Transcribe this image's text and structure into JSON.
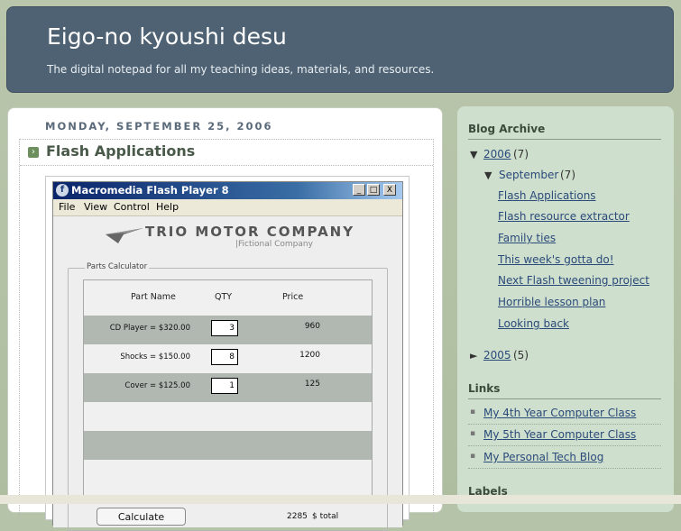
{
  "header": {
    "title": "Eigo-no kyoushi desu",
    "description": "The digital notepad for all my teaching ideas, materials, and resources."
  },
  "post": {
    "date": "MONDAY, SEPTEMBER 25, 2006",
    "title": "Flash Applications",
    "flash": {
      "window_title": "Macromedia Flash Player 8",
      "window_buttons": [
        "_",
        "□",
        "X"
      ],
      "menu": [
        "File",
        "View",
        "Control",
        "Help"
      ],
      "logo_text": "TRIO MOTOR COMPANY",
      "logo_sub": "|Fictional Company",
      "group_label": "Parts Calculator",
      "columns": [
        "Part Name",
        "QTY",
        "Price"
      ],
      "rows": [
        {
          "part": "CD Player = $320.00",
          "qty": "3",
          "price": "960"
        },
        {
          "part": "Shocks  = $150.00",
          "qty": "8",
          "price": "1200"
        },
        {
          "part": "Cover = $125.00",
          "qty": "1",
          "price": "125"
        }
      ],
      "calculate_label": "Calculate",
      "total_value": "2285",
      "total_label": "$ total"
    }
  },
  "sidebar": {
    "archive_heading": "Blog Archive",
    "years": [
      {
        "toggle": "▼",
        "year": "2006",
        "count": "(7)"
      },
      {
        "toggle": "►",
        "year": "2005",
        "count": "(5)"
      }
    ],
    "month": {
      "toggle": "▼",
      "name": "September",
      "count": "(7)"
    },
    "posts": [
      "Flash Applications",
      "Flash resource extractor",
      "Family ties",
      "This week's gotta do!",
      "Next Flash tweening project",
      "Horrible lesson plan",
      "Looking back"
    ],
    "links_heading": "Links",
    "links": [
      "My 4th Year Computer Class",
      "My 5th Year Computer Class",
      "My Personal Tech Blog"
    ],
    "labels_heading": "Labels"
  }
}
